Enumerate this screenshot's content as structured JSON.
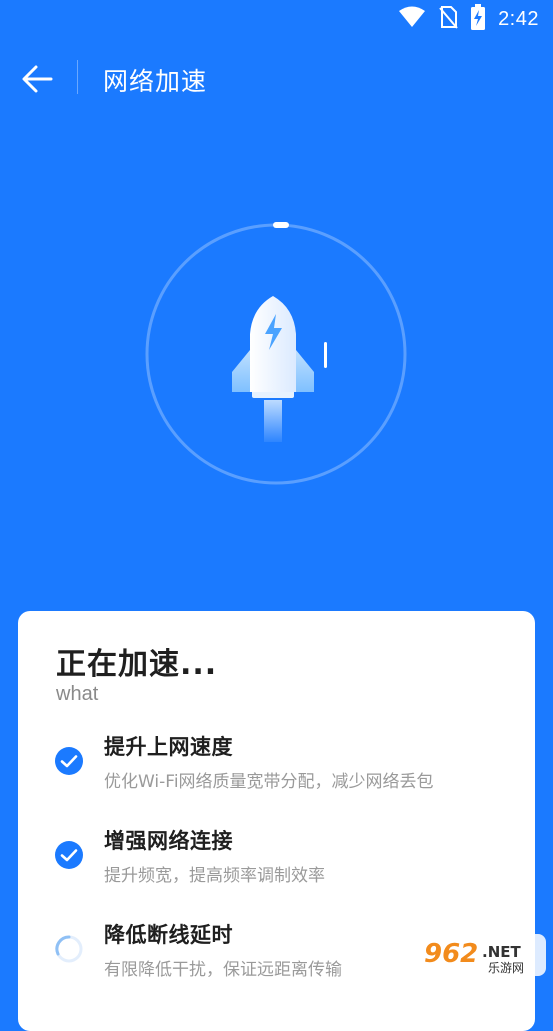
{
  "status_bar": {
    "time": "2:42",
    "icons": [
      "wifi-icon",
      "no-sim-icon",
      "battery-charging-icon"
    ]
  },
  "toolbar": {
    "back_icon": "arrow-left-icon",
    "title": "网络加速"
  },
  "accelerator": {
    "icon": "rocket-icon",
    "background_color": "#1b7aff"
  },
  "card": {
    "title": "正在加速...",
    "subtitle": "what",
    "tasks": [
      {
        "title": "提升上网速度",
        "desc": "优化Wi-Fi网络质量宽带分配，减少网络丢包",
        "state": "done",
        "icon": "check-circle-icon"
      },
      {
        "title": "增强网络连接",
        "desc": "提升频宽，提高频率调制效率",
        "state": "done",
        "icon": "check-circle-icon"
      },
      {
        "title": "降低断线延时",
        "desc": "有限降低干扰，保证远距离传输",
        "state": "loading",
        "icon": "loading-spinner-icon"
      }
    ]
  },
  "watermark": {
    "number": "962",
    "suffix": ".NET",
    "caption": "乐游网"
  },
  "colors": {
    "primary": "#1b7aff",
    "check": "#1b7aff"
  }
}
